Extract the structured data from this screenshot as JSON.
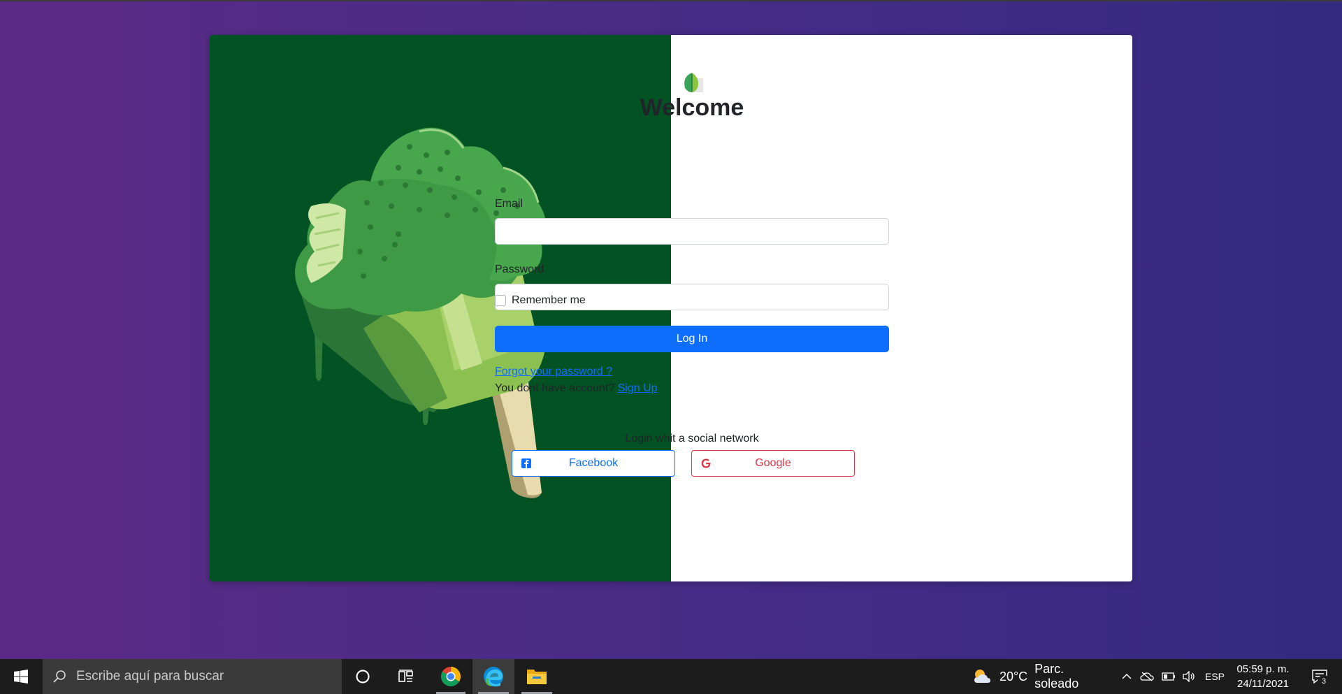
{
  "login": {
    "title": "Welcome",
    "email_label": "Email",
    "email_value": "",
    "password_label": "Password",
    "password_value": "",
    "remember_label": "Remember me",
    "remember_checked": false,
    "login_button": "Log In",
    "forgot_link": "Forgot your password ?",
    "no_account_text": "You dont have account?",
    "signup_link": "Sign Up",
    "social_title": "Login whit a social network",
    "facebook_button": "Facebook",
    "google_button": "Google"
  },
  "colors": {
    "background_left": "#5b2a86",
    "background_right": "#342a80",
    "art_panel": "#025224",
    "primary": "#0d6efd",
    "danger": "#dc3545"
  },
  "taskbar": {
    "search_placeholder": "Escribe aquí para buscar",
    "weather_temp": "20°C",
    "weather_desc": "Parc. soleado",
    "language": "ESP",
    "time": "05:59 p. m.",
    "date": "24/11/2021",
    "notification_count": "3",
    "pinned_apps": [
      "chrome-icon",
      "edge-icon",
      "file-explorer-icon"
    ]
  }
}
